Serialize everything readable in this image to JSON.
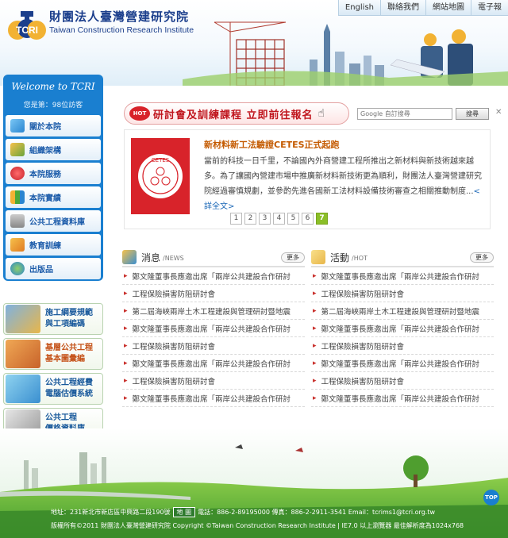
{
  "header": {
    "logo_zh": "財團法人臺灣營建研究院",
    "logo_en": "Taiwan Construction Research Institute",
    "logo_mark": "TCRI",
    "nav": [
      "English",
      "聯絡我們",
      "網站地圖",
      "電子報"
    ]
  },
  "sidebar": {
    "welcome": "Welcome to TCRI",
    "visitor": "您是第：98位訪客",
    "items": [
      {
        "label": "關於本院",
        "icon": "diamond-icon"
      },
      {
        "label": "組織架構",
        "icon": "org-chart-icon"
      },
      {
        "label": "本院服務",
        "icon": "heart-icon"
      },
      {
        "label": "本院實績",
        "icon": "bar-chart-icon"
      },
      {
        "label": "公共工程資料庫",
        "icon": "database-icon"
      },
      {
        "label": "教育訓練",
        "icon": "pencil-icon"
      },
      {
        "label": "出版品",
        "icon": "globe-icon"
      }
    ]
  },
  "quick_links": [
    {
      "line1": "施工綱要規範",
      "line2": "與工項編碼"
    },
    {
      "line1": "基層公共工程",
      "line2": "基本圖彙編"
    },
    {
      "line1": "公共工程經費",
      "line2": "電腦估價系統"
    },
    {
      "line1": "公共工程",
      "line2": "價格資料庫"
    }
  ],
  "banner": {
    "hot": "HOT",
    "text": "研討會及訓練課程  立即前往報名"
  },
  "search": {
    "placeholder": "Google 自訂搜尋",
    "button": "搜尋",
    "close": "✕"
  },
  "featured": {
    "logo_text": "CETES",
    "title": "新材料新工法驗證CETES正式起跑",
    "desc": "當前的科技一日千里，不論國內外商營建工程所推出之新材料與新技術越來越多。為了讓國內營建市場中推廣新材料新技術更為順利，財團法人臺灣營建研究院經過審慎規劃，並參酌先進各國新工法材料設備技術審查之相關推動制度...",
    "more": "<詳全文>"
  },
  "pager": {
    "pages": [
      "1",
      "2",
      "3",
      "4",
      "5",
      "6",
      "7"
    ],
    "active": "7"
  },
  "news": {
    "title": "消息",
    "sub": "/NEWS",
    "more": "更多",
    "items": [
      "鄭文隆董事長應邀出席「兩岸公共建設合作研討",
      "工程保險損害防阻研討會",
      "第二屆海峽兩岸土木工程建設與管理研討暨地震",
      "鄭文隆董事長應邀出席「兩岸公共建設合作研討",
      "工程保險損害防阻研討會",
      "鄭文隆董事長應邀出席「兩岸公共建設合作研討",
      "工程保險損害防阻研討會",
      "鄭文隆董事長應邀出席「兩岸公共建設合作研討"
    ]
  },
  "hot": {
    "title": "活動",
    "sub": "/HOT",
    "more": "更多",
    "items": [
      "鄭文隆董事長應邀出席「兩岸公共建設合作研討",
      "工程保險損害防阻研討會",
      "第二屆海峽兩岸土木工程建設與管理研討暨地震",
      "鄭文隆董事長應邀出席「兩岸公共建設合作研討",
      "工程保險損害防阻研討會",
      "鄭文隆董事長應邀出席「兩岸公共建設合作研討",
      "工程保險損害防阻研討會",
      "鄭文隆董事長應邀出席「兩岸公共建設合作研討"
    ]
  },
  "footer": {
    "addr_before": "地址：231新北市新店區中興路二段190號",
    "map": "地  圖",
    "addr_after": "電話：886-2-89195000    傳真：886-2-2911-3541    Email：tcrims1@tcri.org.tw",
    "copyright": "版權所有©2011 財團法人臺灣營建研究院 Copyright ©Taiwan Construction Research Institute    |    IE7.0 以上瀏覽器 最佳解析度為1024x768",
    "top": "TOP"
  },
  "colors": {
    "brand_blue": "#1a7fd0",
    "accent_red": "#c0161e",
    "active_page": "#8bbf28"
  }
}
